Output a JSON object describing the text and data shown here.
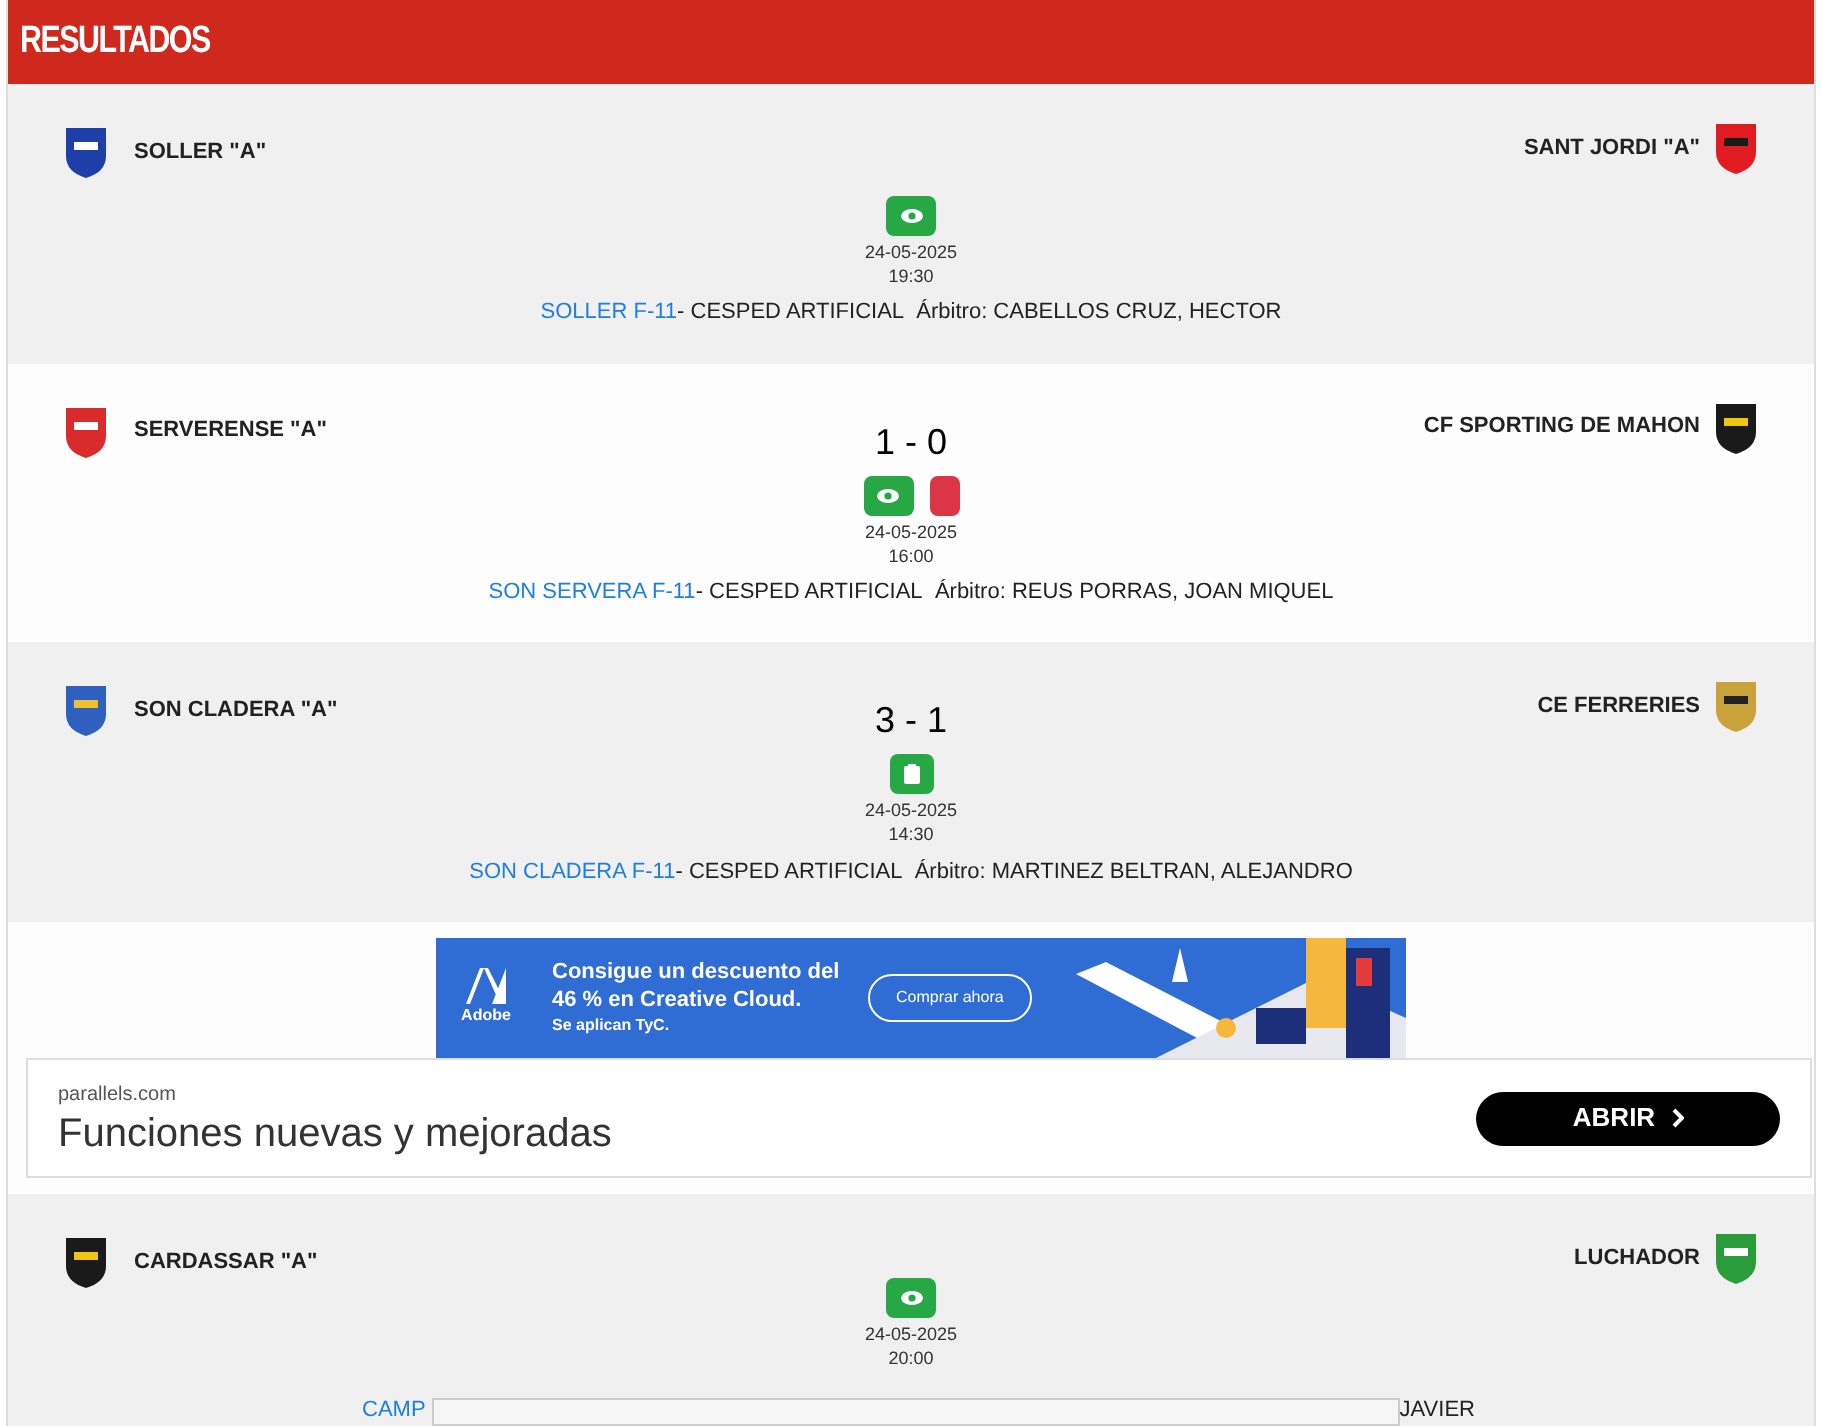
{
  "header": {
    "title": "RESULTADOS"
  },
  "matches": [
    {
      "home": "SOLLER \"A\"",
      "away": "SANT JORDI \"A\"",
      "buttons": [
        {
          "kind": "eye"
        }
      ],
      "date": "24-05-2025",
      "time": "19:30",
      "venue": "SOLLER F-11",
      "surface": "- CESPED ARTIFICIAL",
      "referee": "Árbitro: CABELLOS CRUZ, HECTOR"
    },
    {
      "home": "SERVERENSE \"A\"",
      "away": "CF SPORTING DE MAHON",
      "score": "1 - 0",
      "buttons": [
        {
          "kind": "eye"
        },
        {
          "kind": "red-card"
        }
      ],
      "date": "24-05-2025",
      "time": "16:00",
      "venue": "SON SERVERA F-11",
      "surface": "- CESPED ARTIFICIAL",
      "referee": "Árbitro: REUS PORRAS, JOAN MIQUEL"
    },
    {
      "home": "SON CLADERA \"A\"",
      "away": "CE FERRERIES",
      "score": "3 - 1",
      "buttons": [
        {
          "kind": "report"
        }
      ],
      "date": "24-05-2025",
      "time": "14:30",
      "venue": "SON CLADERA F-11",
      "surface": "- CESPED ARTIFICIAL",
      "referee": "Árbitro: MARTINEZ BELTRAN, ALEJANDRO"
    }
  ],
  "ads": {
    "banner": {
      "headline": "Consigue un descuento del 46 % en Creative Cloud.",
      "terms": "Se aplican TyC.",
      "brand": "Adobe",
      "button": "Comprar ahora"
    },
    "strip": {
      "domain": "parallels.com",
      "headline": "Funciones nuevas y mejoradas",
      "button": "ABRIR"
    }
  },
  "last_match": {
    "home": "CARDASSAR \"A\"",
    "away": "LUCHADOR",
    "buttons": [
      {
        "kind": "eye"
      }
    ],
    "date": "24-05-2025",
    "time": "20:00",
    "venue_fragment": "CAMP",
    "referee_fragment": "JAVIER"
  }
}
